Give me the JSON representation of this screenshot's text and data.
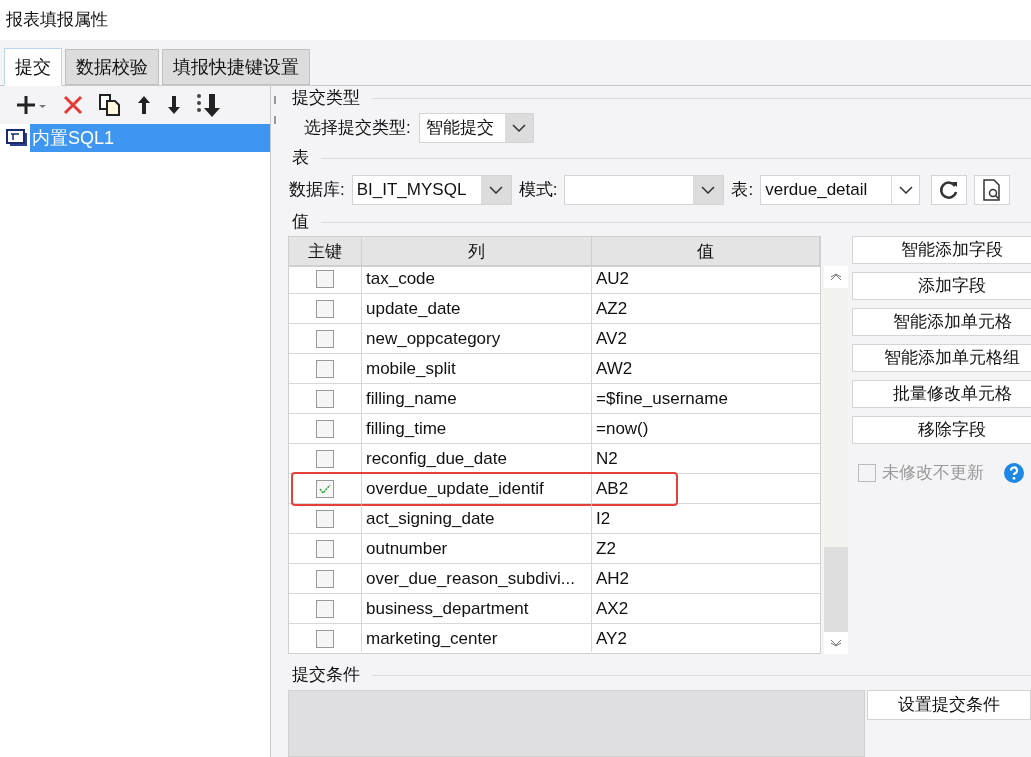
{
  "window": {
    "title": "报表填报属性"
  },
  "tabs": [
    {
      "label": "提交",
      "selected": true
    },
    {
      "label": "数据校验",
      "selected": false
    },
    {
      "label": "填报快捷键设置",
      "selected": false
    }
  ],
  "sidebar": {
    "items": [
      {
        "label": "内置SQL1",
        "selected": true
      }
    ]
  },
  "submit_type": {
    "section": "提交类型",
    "label": "选择提交类型:",
    "value": "智能提交"
  },
  "table_source": {
    "section": "表",
    "fields": [
      {
        "label": "数据库:",
        "value": "BI_IT_MYSQL"
      },
      {
        "label": "模式:"
      },
      {
        "label": "表:",
        "value": "verdue_detail"
      }
    ]
  },
  "values": {
    "section": "值",
    "columns": [
      "主键",
      "列",
      "值"
    ],
    "rows": [
      {
        "column": "tax_code",
        "value": "AU2",
        "checked": false,
        "highlighted": false
      },
      {
        "column": "update_date",
        "value": "AZ2",
        "checked": false,
        "highlighted": false
      },
      {
        "column": "new_oppcategory",
        "value": "AV2",
        "checked": false,
        "highlighted": false
      },
      {
        "column": "mobile_split",
        "value": "AW2",
        "checked": false,
        "highlighted": false
      },
      {
        "column": "filling_name",
        "value": "=$fine_username",
        "checked": false,
        "highlighted": false
      },
      {
        "column": "filling_time",
        "value": "=now()",
        "checked": false,
        "highlighted": false
      },
      {
        "column": "reconfig_due_date",
        "value": "N2",
        "checked": false,
        "highlighted": false
      },
      {
        "column": "overdue_update_identif",
        "value": "AB2",
        "checked": true,
        "highlighted": true
      },
      {
        "column": "act_signing_date",
        "value": "I2",
        "checked": false,
        "highlighted": false
      },
      {
        "column": "outnumber",
        "value": "Z2",
        "checked": false,
        "highlighted": false
      },
      {
        "column": "over_due_reason_subdivi...",
        "value": "AH2",
        "checked": false,
        "highlighted": false
      },
      {
        "column": "business_department",
        "value": "AX2",
        "checked": false,
        "highlighted": false
      },
      {
        "column": "marketing_center",
        "value": "AY2",
        "checked": false,
        "highlighted": false
      }
    ],
    "buttons": [
      "智能添加字段",
      "添加字段",
      "智能添加单元格",
      "智能添加单元格组",
      "批量修改单元格",
      "移除字段"
    ],
    "option": {
      "label": "未修改不更新",
      "checked": false,
      "disabled": true
    }
  },
  "condition": {
    "section": "提交条件",
    "button": "设置提交条件"
  }
}
